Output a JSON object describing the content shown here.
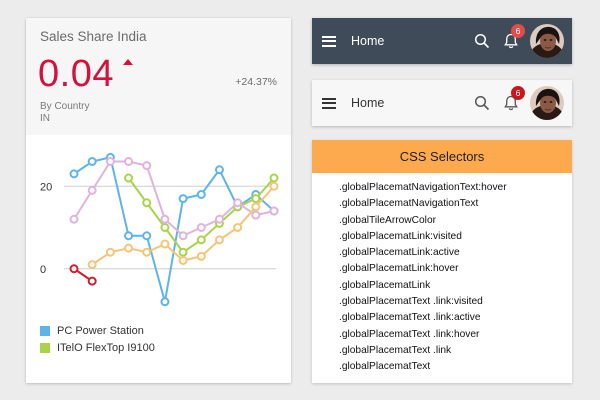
{
  "kpi_card": {
    "title": "Sales Share India",
    "value": "0.04",
    "trend": "up",
    "delta": "+24.37%",
    "subtitle": "By Country",
    "country": "IN"
  },
  "chart_data": {
    "type": "line",
    "x": [
      1,
      2,
      3,
      4,
      5,
      6,
      7,
      8,
      9,
      10,
      11,
      12
    ],
    "yticks": [
      0,
      20
    ],
    "ylim": [
      -10,
      30
    ],
    "grid": true,
    "legend_position": "bottom-left",
    "series": [
      {
        "name": "PC Power Station",
        "color": "#5cb5e8",
        "values": [
          23,
          26,
          27,
          8,
          8,
          -8,
          17,
          18,
          24,
          15,
          18,
          14
        ]
      },
      {
        "name": "ITelO FlexTop I9100",
        "color": "#a8d44a",
        "values": [
          null,
          null,
          null,
          22,
          16,
          10,
          4,
          7,
          11,
          15,
          17,
          22
        ]
      },
      {
        "name": "",
        "color": "#e0b3df",
        "values": [
          12,
          19,
          26,
          26,
          25,
          12,
          8,
          10,
          12,
          16,
          13,
          14
        ]
      },
      {
        "name": "",
        "color": "#e35c9b",
        "values": [
          null,
          null,
          null,
          null,
          null,
          null,
          null,
          null,
          null,
          null,
          null,
          null
        ]
      },
      {
        "name": "",
        "color": "#f5c476",
        "values": [
          null,
          1,
          4,
          5,
          4,
          6,
          2,
          3,
          7,
          10,
          15,
          20
        ]
      },
      {
        "name": "",
        "color": "#cc1f2e",
        "values": [
          0,
          -3,
          null,
          null,
          null,
          null,
          null,
          null,
          null,
          null,
          null,
          null
        ]
      }
    ]
  },
  "legend": [
    {
      "label": "PC Power Station",
      "color": "#5cb5e8"
    },
    {
      "label": "ITelO FlexTop I9100",
      "color": "#a8d44a"
    }
  ],
  "shellbar_dark": {
    "title": "Home",
    "notification_count": "6",
    "icons": [
      "menu-icon",
      "search-icon",
      "bell-icon"
    ]
  },
  "shellbar_light": {
    "title": "Home",
    "notification_count": "6",
    "icons": [
      "menu-icon",
      "search-icon",
      "bell-icon"
    ]
  },
  "css_panel": {
    "header": "CSS Selectors",
    "header_color": "#fda94d",
    "selectors": [
      ".globalPlacematNavigationText:hover",
      ".globalPlacematNavigationText",
      ".globalTileArrowColor",
      ".globalPlacematLink:visited",
      ".globalPlacematLink:active",
      ".globalPlacematLink:hover",
      ".globalPlacematLink",
      ".globalPlacematText .link:visited",
      ".globalPlacematText .link:active",
      ".globalPlacematText .link:hover",
      ".globalPlacematText .link",
      ".globalPlacematText"
    ]
  }
}
